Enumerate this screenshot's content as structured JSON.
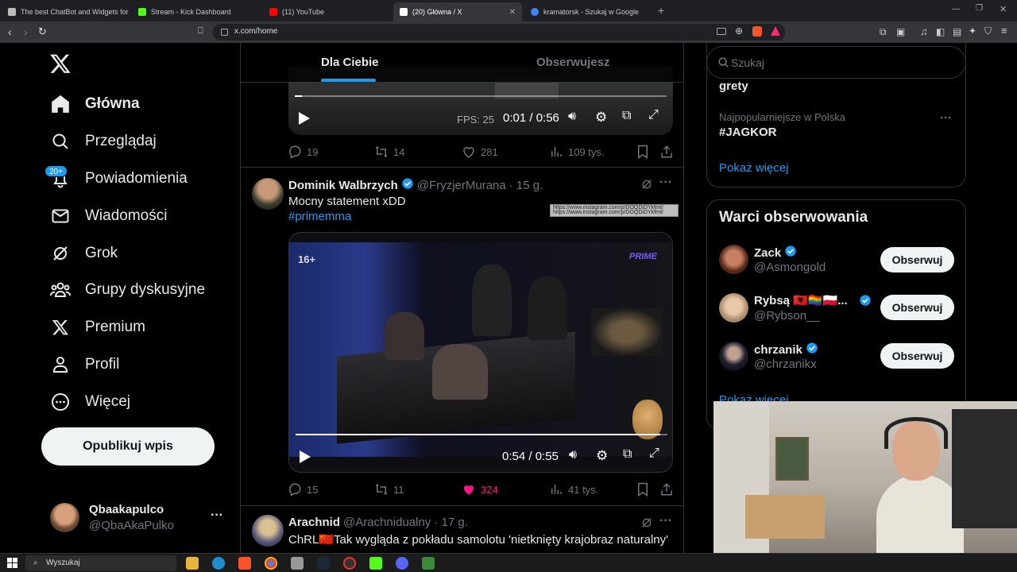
{
  "browser": {
    "tabs": [
      {
        "label": "The best ChatBot and Widgets for Ki",
        "color": "#bbbbbb"
      },
      {
        "label": "Stream - Kick Dashboard",
        "color": "#53fc18"
      },
      {
        "label": "(11) YouTube",
        "color": "#ff0000"
      },
      {
        "label": "(20) Główna / X",
        "color": "#ffffff"
      },
      {
        "label": "kramatorsk - Szukaj w Google",
        "color": "#4285f4"
      }
    ],
    "new_tab": "+",
    "url": "x.com/home"
  },
  "nav": {
    "items": [
      {
        "label": "Główna",
        "icon": "home-icon"
      },
      {
        "label": "Przeglądaj",
        "icon": "search-icon"
      },
      {
        "label": "Powiadomienia",
        "icon": "bell-icon"
      },
      {
        "label": "Wiadomości",
        "icon": "mail-icon"
      },
      {
        "label": "Grok",
        "icon": "grok-icon"
      },
      {
        "label": "Grupy dyskusyjne",
        "icon": "communities-icon"
      },
      {
        "label": "Premium",
        "icon": "x-logo-icon"
      },
      {
        "label": "Profil",
        "icon": "person-icon"
      },
      {
        "label": "Więcej",
        "icon": "more-circle-icon"
      }
    ],
    "notif_badge": "20+",
    "publish": "Opublikuj wpis",
    "account": {
      "name": "Qbaakapulco",
      "handle": "@QbaAkaPulko",
      "more": "···"
    }
  },
  "feed": {
    "tabs": [
      "Dla Ciebie",
      "Obserwujesz"
    ],
    "post1": {
      "video": {
        "fps": "FPS: 25",
        "time": "0:01 / 0:56",
        "progress": 0.02
      },
      "replies": "19",
      "reposts": "14",
      "likes": "281",
      "views": "109 tys."
    },
    "post2": {
      "name": "Dominik Walbrzych",
      "handle": "@FryzjerMurana",
      "time": "· 15 g.",
      "text": "Mocny statement xDD",
      "hashtag": "#primemma",
      "tooltip": "https://www.instagram.com/p/DOQDiDYkfmt/",
      "video": {
        "age": "16+",
        "brand": "PRIME",
        "time": "0:54 / 0:55",
        "progress": 0.98
      },
      "replies": "15",
      "reposts": "11",
      "likes": "324",
      "views": "41 tys."
    },
    "post3": {
      "name": "Arachnid",
      "handle": "@Arachnidualny",
      "time": "· 17 g.",
      "text": "ChRL🇨🇳Tak wygląda z pokładu samolotu 'nietknięty krajobraz naturalny' w"
    }
  },
  "right": {
    "search_placeholder": "Szukaj",
    "trends": {
      "partial": "grety",
      "context": "Najpopularniejsze w Polska",
      "tag": "#JAGKOR",
      "more": "···",
      "show_more": "Pokaż więcej"
    },
    "who_to_follow": {
      "title": "Warci obserwowania",
      "users": [
        {
          "name": "Zack",
          "handle": "@Asmongold",
          "button": "Obserwuj"
        },
        {
          "name": "Rybsą 🇦🇱🏳️‍🌈🇵🇱...",
          "handle": "@Rybson__",
          "button": "Obserwuj"
        },
        {
          "name": "chrzanik",
          "handle": "@chrzanikx",
          "button": "Obserwuj"
        }
      ],
      "show_more": "Pokaż więcej"
    }
  },
  "taskbar": {
    "search": "Wyszukaj"
  },
  "colors": {
    "accent": "#1d9bf0",
    "like": "#f91880",
    "bg": "#000000",
    "border": "#2f3336",
    "muted": "#71767b"
  }
}
